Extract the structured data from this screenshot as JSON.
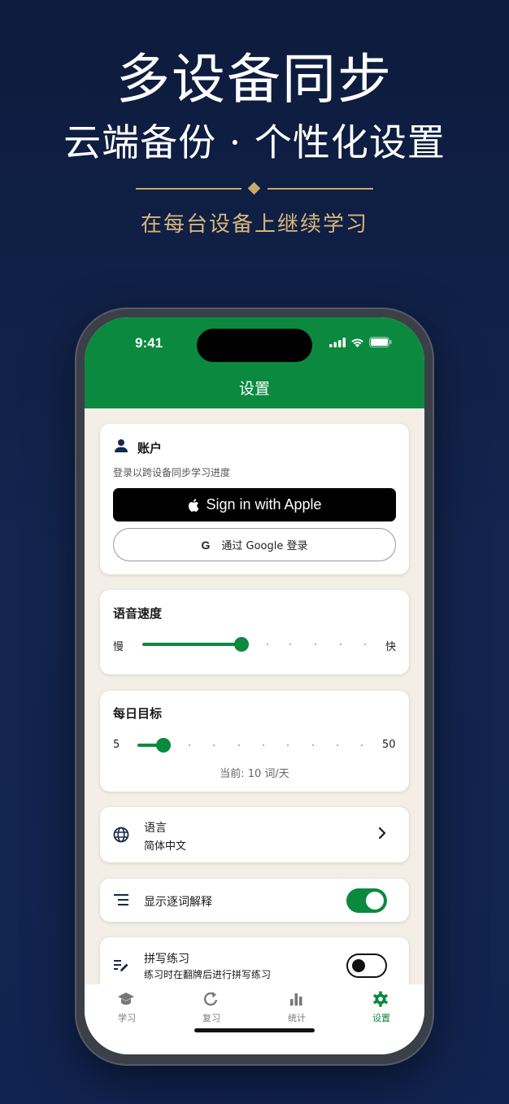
{
  "hero": {
    "title": "多设备同步",
    "subtitle": "云端备份 · 个性化设置",
    "tagline": "在每台设备上继续学习"
  },
  "status_bar": {
    "time": "9:41"
  },
  "header": {
    "title": "设置"
  },
  "account": {
    "title": "账户",
    "description": "登录以跨设备同步学习进度",
    "apple_label": "Sign in with Apple",
    "google_icon": "G",
    "google_label": "通过 Google 登录"
  },
  "speech_speed": {
    "title": "语音速度",
    "min_label": "慢",
    "max_label": "快",
    "value_fraction": 0.38
  },
  "daily_goal": {
    "title": "每日目标",
    "min_label": "5",
    "max_label": "50",
    "value": 10,
    "current_text": "当前: 10 词/天"
  },
  "language": {
    "label": "语言",
    "value": "简体中文",
    "icon": "globe-icon"
  },
  "word_explanation": {
    "label": "显示逐词解释",
    "enabled": true,
    "icon": "list-indent-icon"
  },
  "spelling": {
    "label": "拼写练习",
    "description": "练习时在翻牌后进行拼写练习",
    "enabled": false,
    "icon": "edit-notes-icon"
  },
  "tabs": [
    {
      "label": "学习",
      "icon": "graduation-cap-icon",
      "active": false
    },
    {
      "label": "复习",
      "icon": "refresh-icon",
      "active": false
    },
    {
      "label": "统计",
      "icon": "bar-chart-icon",
      "active": false
    },
    {
      "label": "设置",
      "icon": "gear-icon",
      "active": true
    }
  ],
  "colors": {
    "accent": "#0b8a3f",
    "background": "#0d1b3d",
    "gold": "#c9a86b",
    "screen_bg": "#f3eee6"
  }
}
